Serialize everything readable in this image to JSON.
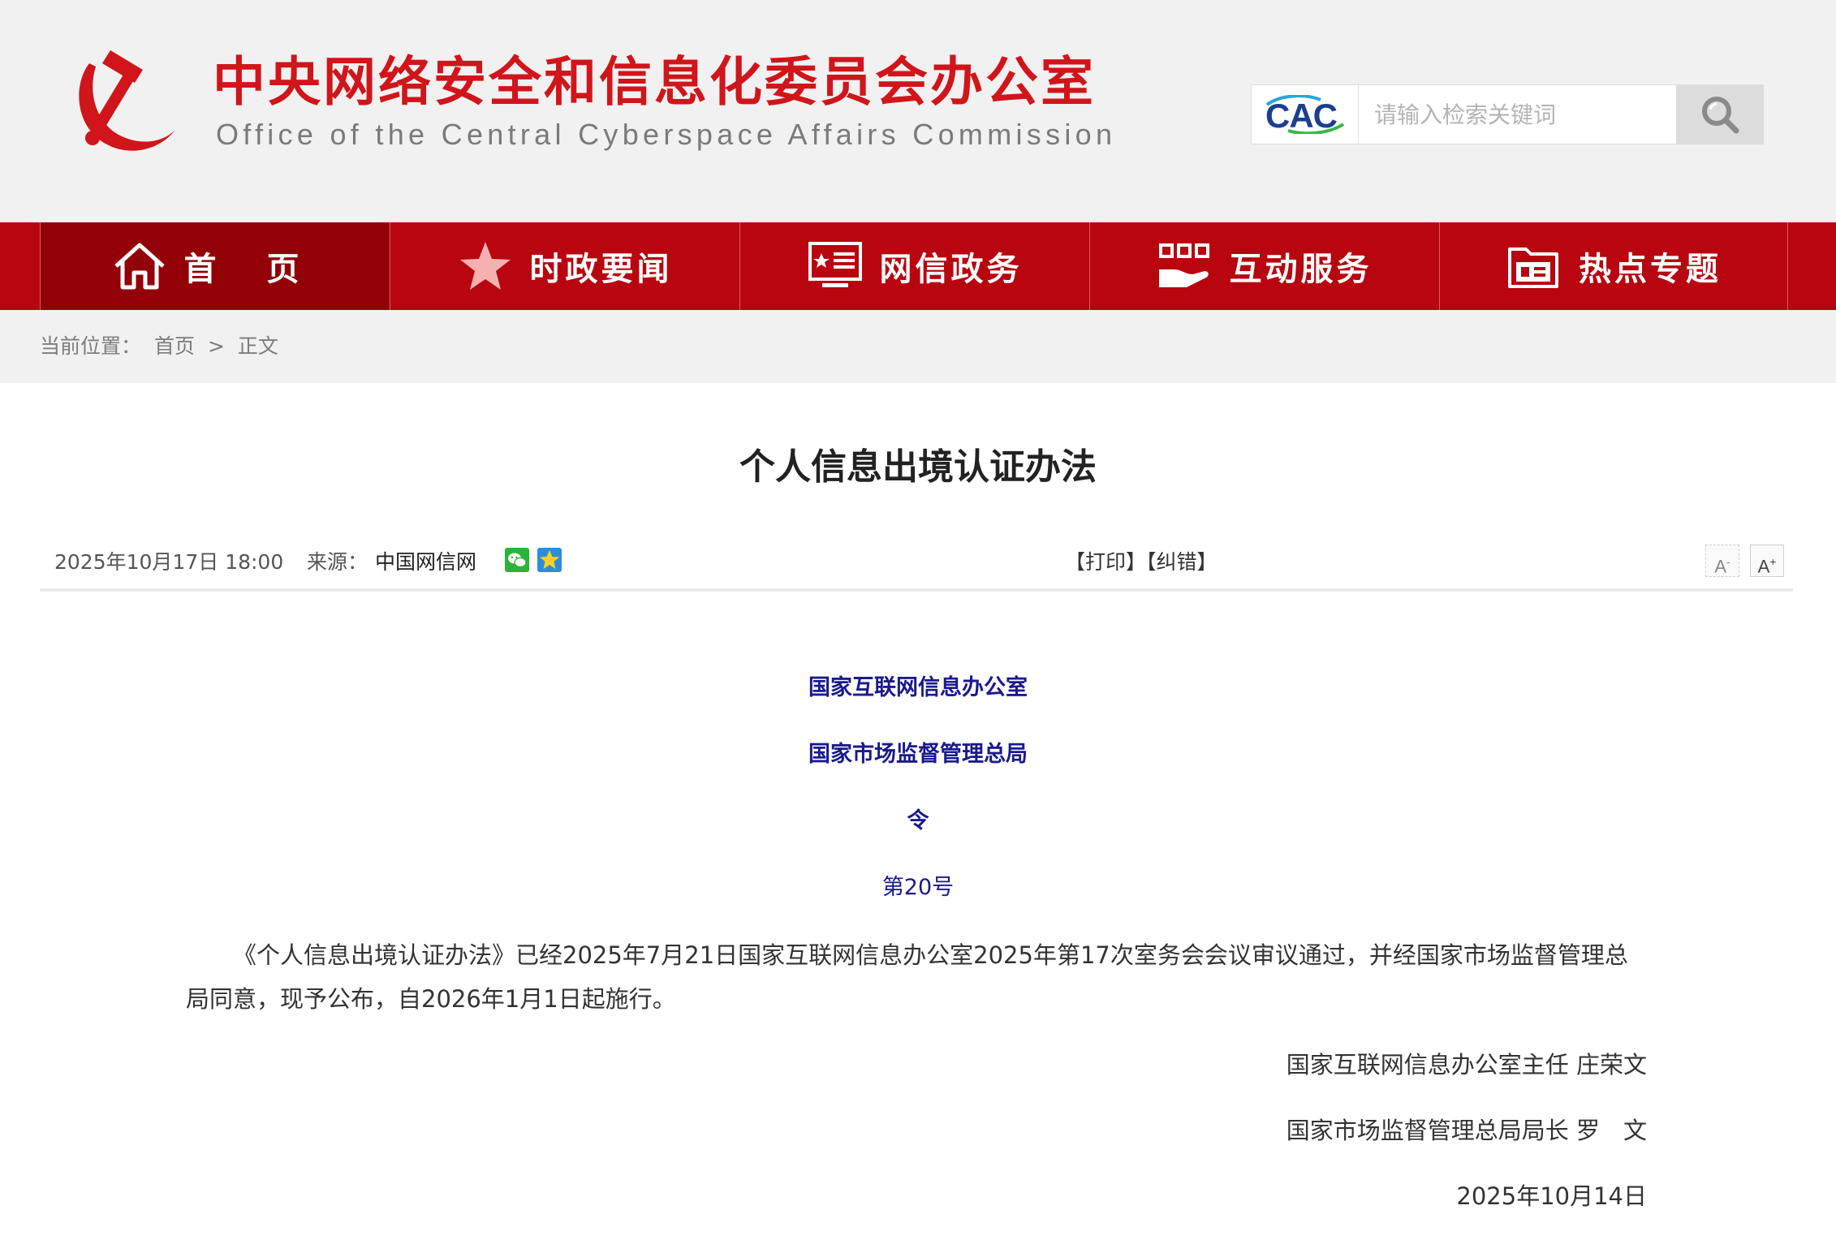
{
  "header": {
    "title_cn": "中央网络安全和信息化委员会办公室",
    "title_en": "Office of the Central Cyberspace Affairs Commission",
    "emblem_icon": "party-emblem-icon",
    "brand_color": "#d0151b"
  },
  "search": {
    "logo_text": "CAC",
    "placeholder": "请输入检索关键词",
    "value": "",
    "button_icon": "search-icon"
  },
  "nav": {
    "background": "#b8050f",
    "active_background": "#930008",
    "items": [
      {
        "label": "首 页",
        "icon": "home-icon",
        "active": true
      },
      {
        "label": "时政要闻",
        "icon": "star-icon",
        "active": false
      },
      {
        "label": "网信政务",
        "icon": "monitor-icon",
        "active": false
      },
      {
        "label": "互动服务",
        "icon": "hand-service-icon",
        "active": false
      },
      {
        "label": "热点专题",
        "icon": "folder-icon",
        "active": false
      }
    ]
  },
  "breadcrumb": {
    "prefix": "当前位置：",
    "home": "首页",
    "separator": ">",
    "current": "正文"
  },
  "article": {
    "title": "个人信息出境认证办法",
    "date": "2025年10月17日 18:00",
    "source_label": "来源：",
    "source": "中国网信网",
    "share": [
      "wechat-icon",
      "qzone-icon"
    ],
    "actions": {
      "print": "【打印】",
      "correct": "【纠错】"
    },
    "font_controls": {
      "decrease": "A",
      "decrease_sign": "-",
      "increase": "A",
      "increase_sign": "+"
    },
    "issuers": [
      "国家互联网信息办公室",
      "国家市场监督管理总局"
    ],
    "order_word": "令",
    "order_number": "第20号",
    "body": "《个人信息出境认证办法》已经2025年7月21日国家互联网信息办公室2025年第17次室务会会议审议通过，并经国家市场监督管理总局同意，现予公布，自2026年1月1日起施行。",
    "signatures": [
      "国家互联网信息办公室主任 庄荣文",
      "国家市场监督管理总局局长 罗　文"
    ],
    "sign_date": "2025年10月14日"
  }
}
